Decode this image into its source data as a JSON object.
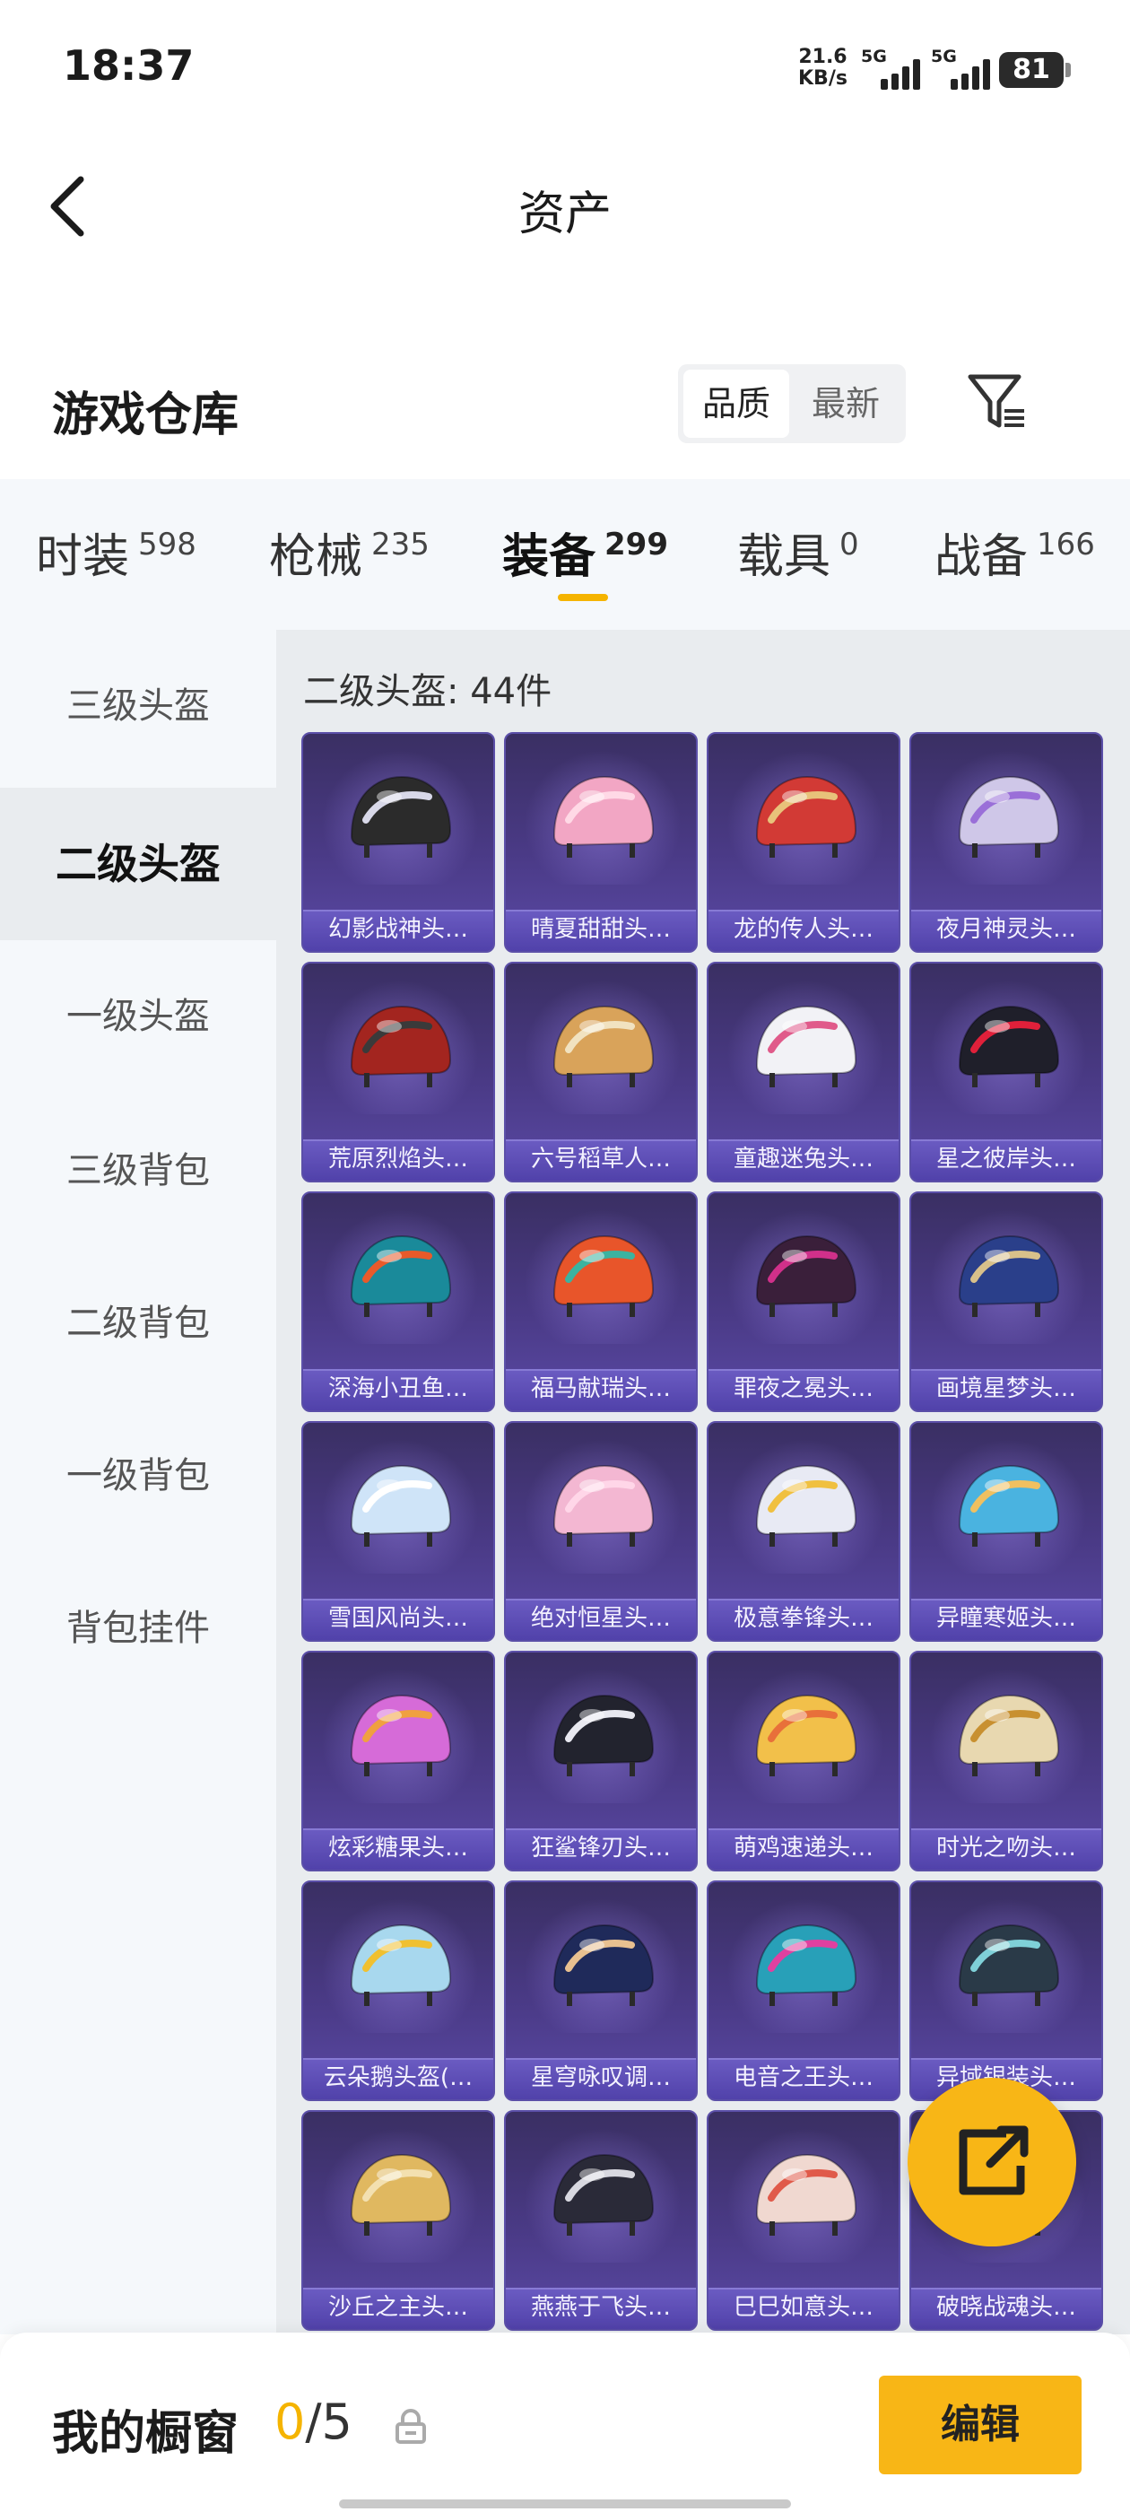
{
  "status": {
    "time": "18:37",
    "speed_value": "21.6",
    "speed_unit": "KB/s",
    "sim1": "5G",
    "sim2": "5G",
    "battery": "81"
  },
  "nav": {
    "title": "资产",
    "back_icon": "back-arrow-icon"
  },
  "section": {
    "title": "游戏仓库",
    "sort_options": [
      "品质",
      "最新"
    ],
    "sort_selected": "品质",
    "filter_icon": "filter-icon"
  },
  "tabs": [
    {
      "label": "时装",
      "count": "598"
    },
    {
      "label": "枪械",
      "count": "235"
    },
    {
      "label": "装备",
      "count": "299"
    },
    {
      "label": "载具",
      "count": "0"
    },
    {
      "label": "战备",
      "count": "166"
    }
  ],
  "active_tab": "装备",
  "sidebar": {
    "items": [
      "三级头盔",
      "二级头盔",
      "一级头盔",
      "三级背包",
      "二级背包",
      "一级背包",
      "背包挂件"
    ],
    "active": "二级头盔"
  },
  "content": {
    "title": "二级头盔: 44件",
    "items": [
      {
        "name": "幻影战神头…",
        "color": "#2b2b2b",
        "accent": "#d8d8e8"
      },
      {
        "name": "晴夏甜甜头…",
        "color": "#f2a6c4",
        "accent": "#ffd9e6"
      },
      {
        "name": "龙的传人头…",
        "color": "#d23a35",
        "accent": "#e8c27a"
      },
      {
        "name": "夜月神灵头…",
        "color": "#cfc7e8",
        "accent": "#9a6fd8"
      },
      {
        "name": "荒原烈焰头…",
        "color": "#a3251f",
        "accent": "#3a3a3a"
      },
      {
        "name": "六号稻草人…",
        "color": "#d9a35a",
        "accent": "#f1e2c0"
      },
      {
        "name": "童趣迷兔头…",
        "color": "#f2f2f6",
        "accent": "#e05a8a"
      },
      {
        "name": "星之彼岸头…",
        "color": "#1f1f2a",
        "accent": "#e0203a"
      },
      {
        "name": "深海小丑鱼…",
        "color": "#1a8a9a",
        "accent": "#e85a2a"
      },
      {
        "name": "福马献瑞头…",
        "color": "#e8552a",
        "accent": "#3bb3a0"
      },
      {
        "name": "罪夜之冕头…",
        "color": "#3a1f3a",
        "accent": "#d0308a"
      },
      {
        "name": "画境星梦头…",
        "color": "#2a3f8a",
        "accent": "#d8c08a"
      },
      {
        "name": "雪国风尚头…",
        "color": "#cfe4f8",
        "accent": "#ffffff"
      },
      {
        "name": "绝对恒星头…",
        "color": "#f3b7d2",
        "accent": "#ffd6e8"
      },
      {
        "name": "极意拳锋头…",
        "color": "#e8eaf4",
        "accent": "#f0c040"
      },
      {
        "name": "异瞳寒姬头…",
        "color": "#4ab3e0",
        "accent": "#f0c060"
      },
      {
        "name": "炫彩糖果头…",
        "color": "#d66bd8",
        "accent": "#f0a040"
      },
      {
        "name": "狂鲨锋刃头…",
        "color": "#22232e",
        "accent": "#e8e8f0"
      },
      {
        "name": "萌鸡速递头…",
        "color": "#f2c04a",
        "accent": "#e8703a"
      },
      {
        "name": "时光之吻头…",
        "color": "#e8d8b0",
        "accent": "#c89030"
      },
      {
        "name": "云朵鹅头盔(…",
        "color": "#a8d8ee",
        "accent": "#f0c030"
      },
      {
        "name": "星穹咏叹调…",
        "color": "#1f2a5a",
        "accent": "#e8c090"
      },
      {
        "name": "电音之王头…",
        "color": "#28a0b8",
        "accent": "#e040a0"
      },
      {
        "name": "异域银装头…",
        "color": "#2a3a48",
        "accent": "#7fd0d8"
      },
      {
        "name": "沙丘之主头…",
        "color": "#e0b860",
        "accent": "#f3e0b0"
      },
      {
        "name": "燕燕于飞头…",
        "color": "#2a2a38",
        "accent": "#d8d8e0"
      },
      {
        "name": "巳巳如意头…",
        "color": "#f0d8d0",
        "accent": "#e05a4a"
      },
      {
        "name": "破晓战魂头…",
        "color": "#4a4a5a",
        "accent": "#c0c0d0"
      }
    ]
  },
  "fab": {
    "icon": "share-icon"
  },
  "bottom": {
    "showcase_label": "我的橱窗",
    "showcase_current": "0",
    "showcase_total": "/5",
    "lock_icon": "lock-icon",
    "edit_label": "编辑"
  }
}
